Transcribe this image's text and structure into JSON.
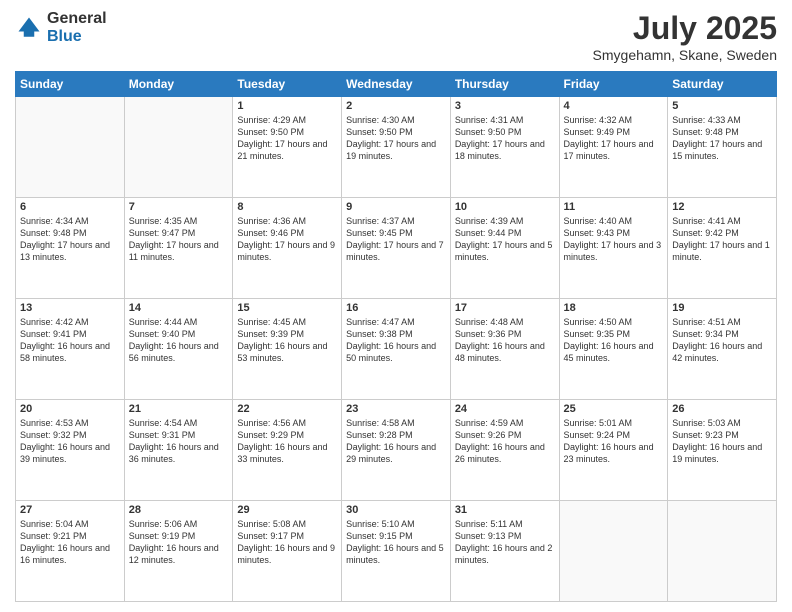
{
  "header": {
    "logo_general": "General",
    "logo_blue": "Blue",
    "month_year": "July 2025",
    "location": "Smygehamn, Skane, Sweden"
  },
  "days_of_week": [
    "Sunday",
    "Monday",
    "Tuesday",
    "Wednesday",
    "Thursday",
    "Friday",
    "Saturday"
  ],
  "weeks": [
    [
      {
        "day": "",
        "info": ""
      },
      {
        "day": "",
        "info": ""
      },
      {
        "day": "1",
        "info": "Sunrise: 4:29 AM\nSunset: 9:50 PM\nDaylight: 17 hours and 21 minutes."
      },
      {
        "day": "2",
        "info": "Sunrise: 4:30 AM\nSunset: 9:50 PM\nDaylight: 17 hours and 19 minutes."
      },
      {
        "day": "3",
        "info": "Sunrise: 4:31 AM\nSunset: 9:50 PM\nDaylight: 17 hours and 18 minutes."
      },
      {
        "day": "4",
        "info": "Sunrise: 4:32 AM\nSunset: 9:49 PM\nDaylight: 17 hours and 17 minutes."
      },
      {
        "day": "5",
        "info": "Sunrise: 4:33 AM\nSunset: 9:48 PM\nDaylight: 17 hours and 15 minutes."
      }
    ],
    [
      {
        "day": "6",
        "info": "Sunrise: 4:34 AM\nSunset: 9:48 PM\nDaylight: 17 hours and 13 minutes."
      },
      {
        "day": "7",
        "info": "Sunrise: 4:35 AM\nSunset: 9:47 PM\nDaylight: 17 hours and 11 minutes."
      },
      {
        "day": "8",
        "info": "Sunrise: 4:36 AM\nSunset: 9:46 PM\nDaylight: 17 hours and 9 minutes."
      },
      {
        "day": "9",
        "info": "Sunrise: 4:37 AM\nSunset: 9:45 PM\nDaylight: 17 hours and 7 minutes."
      },
      {
        "day": "10",
        "info": "Sunrise: 4:39 AM\nSunset: 9:44 PM\nDaylight: 17 hours and 5 minutes."
      },
      {
        "day": "11",
        "info": "Sunrise: 4:40 AM\nSunset: 9:43 PM\nDaylight: 17 hours and 3 minutes."
      },
      {
        "day": "12",
        "info": "Sunrise: 4:41 AM\nSunset: 9:42 PM\nDaylight: 17 hours and 1 minute."
      }
    ],
    [
      {
        "day": "13",
        "info": "Sunrise: 4:42 AM\nSunset: 9:41 PM\nDaylight: 16 hours and 58 minutes."
      },
      {
        "day": "14",
        "info": "Sunrise: 4:44 AM\nSunset: 9:40 PM\nDaylight: 16 hours and 56 minutes."
      },
      {
        "day": "15",
        "info": "Sunrise: 4:45 AM\nSunset: 9:39 PM\nDaylight: 16 hours and 53 minutes."
      },
      {
        "day": "16",
        "info": "Sunrise: 4:47 AM\nSunset: 9:38 PM\nDaylight: 16 hours and 50 minutes."
      },
      {
        "day": "17",
        "info": "Sunrise: 4:48 AM\nSunset: 9:36 PM\nDaylight: 16 hours and 48 minutes."
      },
      {
        "day": "18",
        "info": "Sunrise: 4:50 AM\nSunset: 9:35 PM\nDaylight: 16 hours and 45 minutes."
      },
      {
        "day": "19",
        "info": "Sunrise: 4:51 AM\nSunset: 9:34 PM\nDaylight: 16 hours and 42 minutes."
      }
    ],
    [
      {
        "day": "20",
        "info": "Sunrise: 4:53 AM\nSunset: 9:32 PM\nDaylight: 16 hours and 39 minutes."
      },
      {
        "day": "21",
        "info": "Sunrise: 4:54 AM\nSunset: 9:31 PM\nDaylight: 16 hours and 36 minutes."
      },
      {
        "day": "22",
        "info": "Sunrise: 4:56 AM\nSunset: 9:29 PM\nDaylight: 16 hours and 33 minutes."
      },
      {
        "day": "23",
        "info": "Sunrise: 4:58 AM\nSunset: 9:28 PM\nDaylight: 16 hours and 29 minutes."
      },
      {
        "day": "24",
        "info": "Sunrise: 4:59 AM\nSunset: 9:26 PM\nDaylight: 16 hours and 26 minutes."
      },
      {
        "day": "25",
        "info": "Sunrise: 5:01 AM\nSunset: 9:24 PM\nDaylight: 16 hours and 23 minutes."
      },
      {
        "day": "26",
        "info": "Sunrise: 5:03 AM\nSunset: 9:23 PM\nDaylight: 16 hours and 19 minutes."
      }
    ],
    [
      {
        "day": "27",
        "info": "Sunrise: 5:04 AM\nSunset: 9:21 PM\nDaylight: 16 hours and 16 minutes."
      },
      {
        "day": "28",
        "info": "Sunrise: 5:06 AM\nSunset: 9:19 PM\nDaylight: 16 hours and 12 minutes."
      },
      {
        "day": "29",
        "info": "Sunrise: 5:08 AM\nSunset: 9:17 PM\nDaylight: 16 hours and 9 minutes."
      },
      {
        "day": "30",
        "info": "Sunrise: 5:10 AM\nSunset: 9:15 PM\nDaylight: 16 hours and 5 minutes."
      },
      {
        "day": "31",
        "info": "Sunrise: 5:11 AM\nSunset: 9:13 PM\nDaylight: 16 hours and 2 minutes."
      },
      {
        "day": "",
        "info": ""
      },
      {
        "day": "",
        "info": ""
      }
    ]
  ]
}
